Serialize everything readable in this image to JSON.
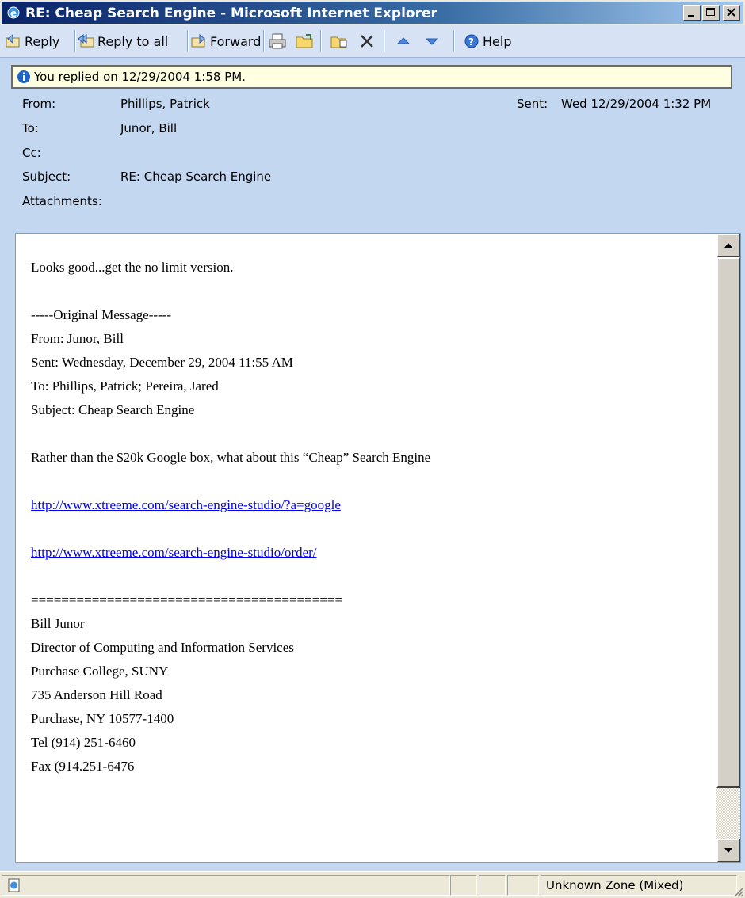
{
  "window": {
    "title": "RE: Cheap Search Engine - Microsoft Internet Explorer"
  },
  "toolbar": {
    "reply_label": "Reply",
    "reply_all_label": "Reply to all",
    "forward_label": "Forward",
    "help_label": "Help"
  },
  "infobar": {
    "text": "You replied on 12/29/2004 1:58 PM."
  },
  "header": {
    "from_label": "From:",
    "from_value": "Phillips, Patrick",
    "to_label": "To:",
    "to_value": "Junor, Bill",
    "cc_label": "Cc:",
    "subject_label": "Subject:",
    "subject_value": "RE: Cheap Search Engine",
    "attachments_label": "Attachments:",
    "sent_label": "Sent:",
    "sent_value": "Wed 12/29/2004 1:32 PM"
  },
  "message": {
    "reply_text": "Looks good...get the no limit version.",
    "original_marker": "-----Original Message-----",
    "orig_from": "From: Junor, Bill",
    "orig_sent": "Sent: Wednesday, December 29, 2004 11:55 AM",
    "orig_to": "To: Phillips, Patrick; Pereira, Jared",
    "orig_subject": "Subject: Cheap Search Engine",
    "body_text": "Rather than the $20k Google box, what about this “Cheap” Search Engine",
    "link1": "http://www.xtreeme.com/search-engine-studio/?a=google",
    "link2": "http://www.xtreeme.com/search-engine-studio/order/",
    "separator": "=========================================",
    "sig_name": "Bill Junor",
    "sig_title": "Director of Computing and Information Services",
    "sig_org": "Purchase College, SUNY",
    "sig_address1": "735 Anderson Hill Road",
    "sig_address2": "Purchase, NY 10577-1400",
    "sig_tel": "Tel (914) 251-6460",
    "sig_fax": "Fax (914.251-6476"
  },
  "statusbar": {
    "zone": "Unknown Zone (Mixed)"
  }
}
